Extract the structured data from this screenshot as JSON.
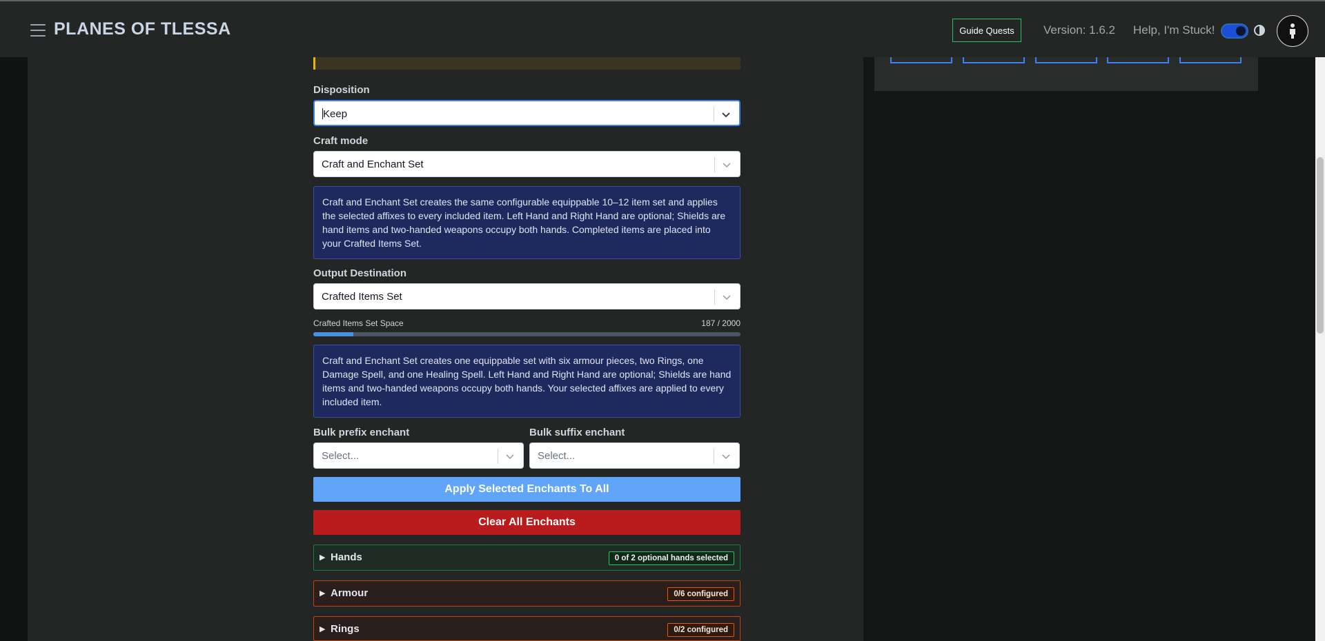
{
  "header": {
    "brand": "PLANES OF TLESSA",
    "guide_quests": "Guide Quests",
    "version": "Version: 1.6.2",
    "help": "Help, I'm Stuck!",
    "icons": [
      "menu-icon",
      "theme-toggle",
      "contrast-icon",
      "user-avatar-icon"
    ]
  },
  "form": {
    "disposition": {
      "label": "Disposition",
      "value": "Keep"
    },
    "craft_mode": {
      "label": "Craft mode",
      "value": "Craft and Enchant Set"
    },
    "craft_mode_info": "Craft and Enchant Set creates the same configurable equippable 10–12 item set and applies the selected affixes to every included item. Left Hand and Right Hand are optional; Shields are hand items and two-handed weapons occupy both hands. Completed items are placed into your Crafted Items Set.",
    "output_destination": {
      "label": "Output Destination",
      "value": "Crafted Items Set"
    },
    "set_space": {
      "label": "Crafted Items Set Space",
      "count": "187 / 2000",
      "used": 187,
      "max": 2000
    },
    "set_info": "Craft and Enchant Set creates one equippable set with six armour pieces, two Rings, one Damage Spell, and one Healing Spell. Left Hand and Right Hand are optional; Shields are hand items and two-handed weapons occupy both hands. Your selected affixes are applied to every included item.",
    "bulk_prefix": {
      "label": "Bulk prefix enchant",
      "placeholder": "Select..."
    },
    "bulk_suffix": {
      "label": "Bulk suffix enchant",
      "placeholder": "Select..."
    },
    "apply_button": "Apply Selected Enchants To All",
    "clear_button": "Clear All Enchants",
    "sections": [
      {
        "title": "Hands",
        "badge": "0 of 2 optional hands selected",
        "arrow": "▶"
      },
      {
        "title": "Armour",
        "badge": "0/6 configured",
        "arrow": "▶"
      },
      {
        "title": "Rings",
        "badge": "0/2 configured",
        "arrow": "▶"
      }
    ]
  },
  "colors": {
    "accent_blue": "#60a5fa",
    "danger_red": "#b91c1c",
    "success_green": "#22c55e",
    "warning_orange": "#ea580c",
    "info_bg": "#1e2a5e"
  }
}
